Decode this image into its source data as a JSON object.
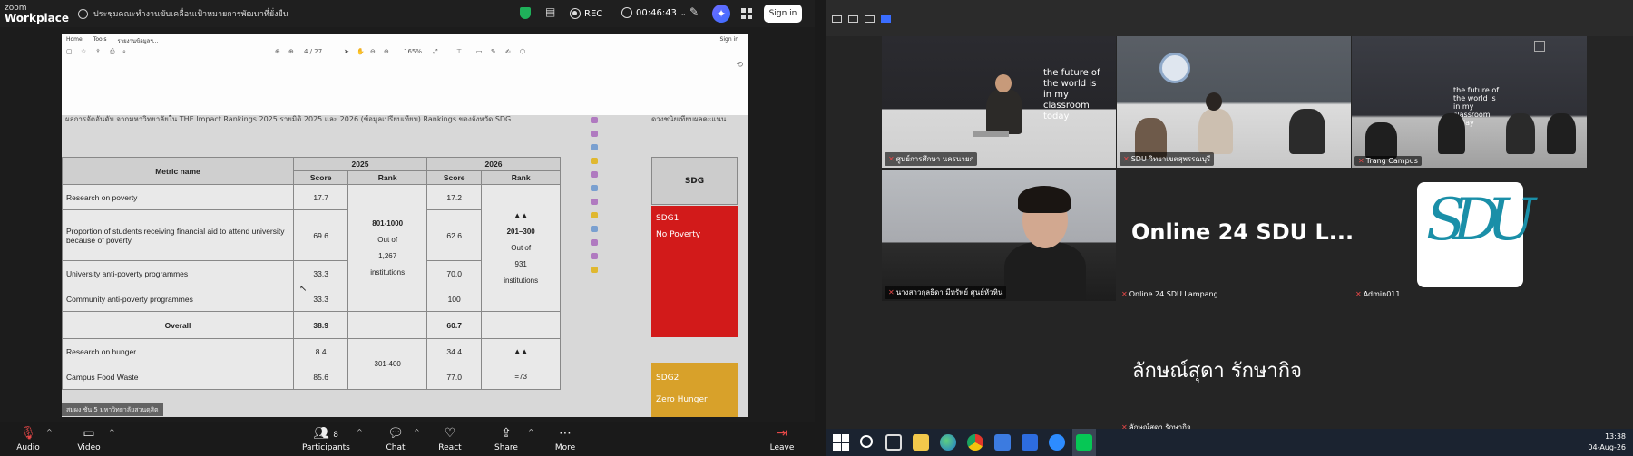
{
  "zoom": {
    "brand_line1": "zoom",
    "brand_line2": "Workplace",
    "meeting_title": "ประชุมคณะทำงานขับเคลื่อนเป้าหมายการพัฒนาที่ยั่งยืน",
    "rec_label": "REC",
    "timer": "00:46:43",
    "signin_label": "Sign in",
    "toolbar": {
      "audio": "Audio",
      "video": "Video",
      "participants": "Participants",
      "participants_count": "8",
      "chat": "Chat",
      "react": "React",
      "share": "Share",
      "more": "More",
      "leave": "Leave"
    }
  },
  "shared_doc": {
    "menu": [
      "Home",
      "Tools",
      "รายงานข้อมูลฯ..."
    ],
    "signin": "Sign in",
    "page_indicator": "4 / 27",
    "zoom_level": "165%",
    "header_text": "ผลการจัดอันดับ จากมหาวิทยาลัยใน THE Impact Rankings 2025 รายมิติ 2025 และ 2026 (ข้อมูลเปรียบเทียบ) Rankings ของจังหวัด SDG",
    "right_header_text": "ดวงชนิยเทียบผลคะแนน",
    "table": {
      "col_metric": "Metric name",
      "year1": "2025",
      "year2": "2026",
      "col_score": "Score",
      "col_rank": "Rank",
      "rows": [
        {
          "metric": "Research on poverty",
          "s1": "17.7",
          "s2": "17.2"
        },
        {
          "metric": "Proportion of students receiving financial aid to attend university because of poverty",
          "s1": "69.6",
          "s2": "62.6"
        },
        {
          "metric": "University anti-poverty programmes",
          "s1": "33.3",
          "s2": "70.0"
        },
        {
          "metric": "Community anti-poverty programmes",
          "s1": "33.3",
          "s2": "100"
        },
        {
          "metric": "Overall",
          "s1": "38.9",
          "s2": "60.7"
        },
        {
          "metric": "Research on hunger",
          "s1": "8.4",
          "s2": "34.4"
        },
        {
          "metric": "Campus Food Waste",
          "s1": "85.6",
          "s2": "77.0"
        }
      ],
      "rank1_a": "801-1000",
      "rank1_b": "Out of",
      "rank1_c": "1,267",
      "rank1_d": "institutions",
      "rank2_up": "▲▲",
      "rank2_a": "201–300",
      "rank2_b": "Out of",
      "rank2_c": "931",
      "rank2_d": "institutions",
      "rank3_a": "301-400",
      "rank4_up": "▲▲",
      "rank4_a": "=73"
    },
    "sdg_head": "SDG",
    "sdg1_code": "SDG1",
    "sdg1_name": "No Poverty",
    "sdg2_code": "SDG2",
    "sdg2_name": "Zero Hunger",
    "share_badge": "สมผง ชัน 5 มหาวิทยาลัยสวนดุสิต"
  },
  "gallery": {
    "tiles": [
      {
        "name": "ศูนย์การศึกษา นครนายก"
      },
      {
        "name": "SDU วิทยาเขตสุพรรณบุรี"
      },
      {
        "name": "Trang Campus"
      },
      {
        "name": "นางสาวกุลธิดา มีทรัพย์ ศูนย์หัวหิน"
      }
    ],
    "wall_text": "the future of the world is in my classroom today",
    "big_name": "Online 24 SDU L...",
    "big_name_label": "Online 24 SDU Lampang",
    "logo_label": "Admin011",
    "thai_name": "ลักษณ์สุดา รักษากิจ",
    "thai_name_label": "ลักษณ์สุดา รักษากิจ"
  },
  "taskbar": {
    "time": "13:38",
    "date": "04-Aug-26"
  }
}
